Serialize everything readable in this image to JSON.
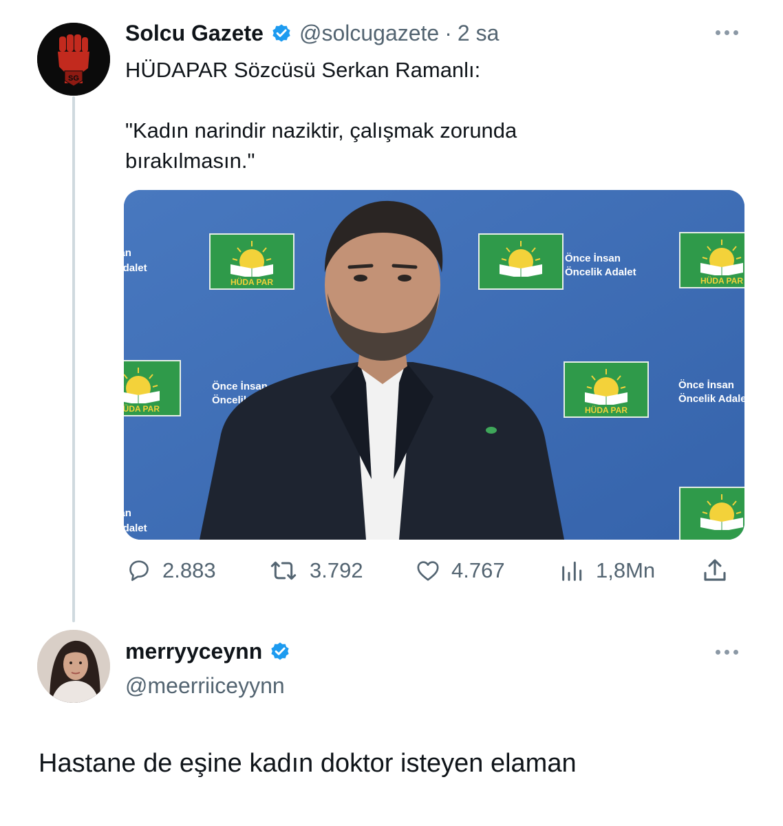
{
  "tweet": {
    "author_name": "Solcu Gazete",
    "author_handle": "@solcugazete",
    "separator": "·",
    "time": "2 sa",
    "avatar_text": "SG",
    "text_line1": "HÜDAPAR Sözcüsü Serkan Ramanlı:",
    "text_line2": "\"Kadın narindir naziktir, çalışmak zorunda",
    "text_line3": "bırakılmasın.\"",
    "media": {
      "slogan_line1": "Önce İnsan",
      "slogan_line2": "Öncelik Adalet",
      "party_label": "HÜDA PAR"
    },
    "stats": {
      "replies": "2.883",
      "retweets": "3.792",
      "likes": "4.767",
      "views": "1,8Mn"
    }
  },
  "reply": {
    "author_name": "merryyceynn",
    "author_handle": "@meerriiceyynn",
    "text": "Hastane de eşine kadın doktor isteyen elaman"
  },
  "colors": {
    "verified": "#1d9bf0",
    "secondary_text": "#536471",
    "media_background": "#3f6db4",
    "party_green": "#2f9a4a"
  }
}
